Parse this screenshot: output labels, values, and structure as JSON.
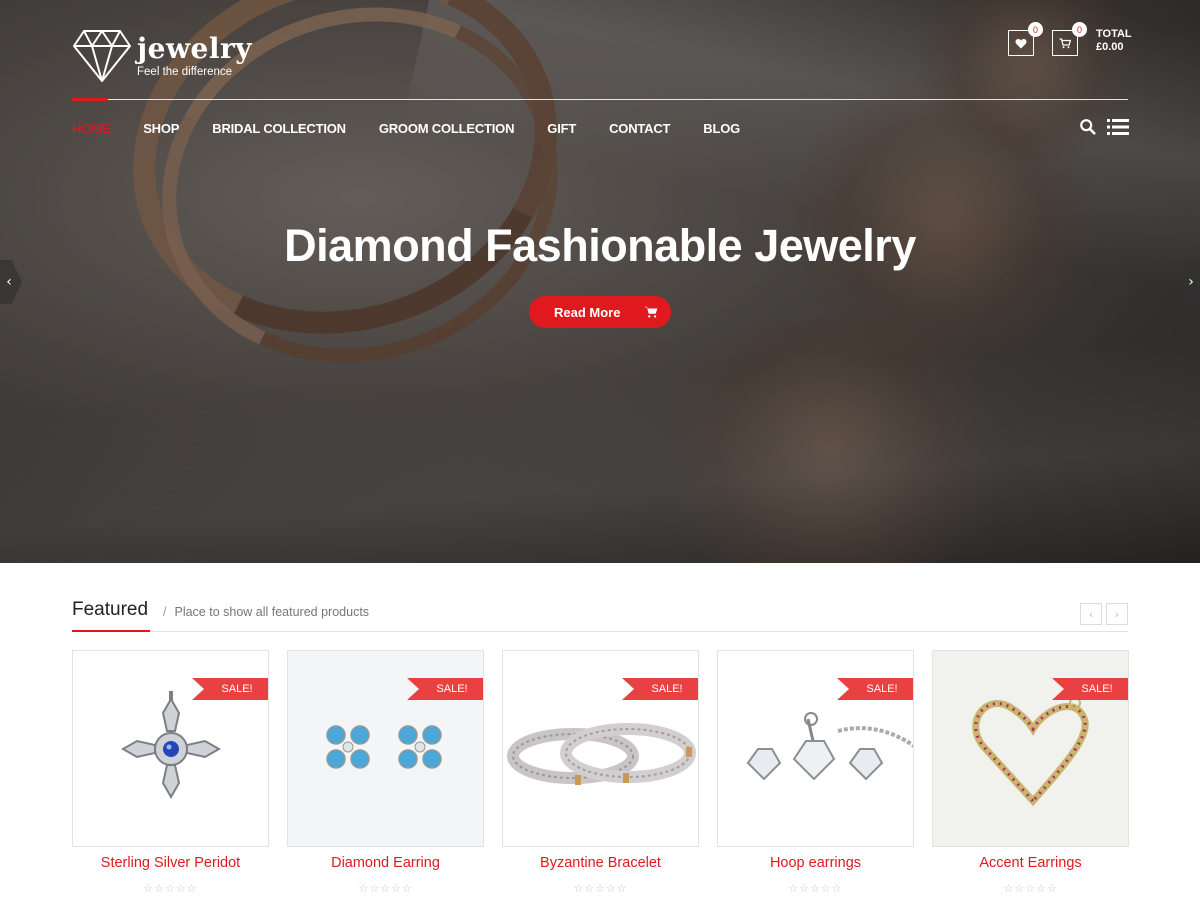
{
  "brand": {
    "name": "jewelry",
    "tagline": "Feel the difference"
  },
  "header": {
    "wishlist_count": "0",
    "cart_count": "0",
    "total_label": "TOTAL",
    "total_value": "£0.00"
  },
  "nav": {
    "items": [
      "HOME",
      "SHOP",
      "BRIDAL COLLECTION",
      "GROOM COLLECTION",
      "GIFT",
      "CONTACT",
      "BLOG"
    ],
    "active_index": 0
  },
  "hero": {
    "title": "Diamond Fashionable Jewelry",
    "button_label": "Read More",
    "prev_arrow": "‹",
    "next_arrow": "›"
  },
  "featured": {
    "title": "Featured",
    "separator": "/",
    "subtitle": "Place to show all featured products",
    "prev": "‹",
    "next": "›",
    "products": [
      {
        "name": "Sterling Silver Peridot",
        "badge": "SALE!",
        "rating": "☆☆☆☆☆"
      },
      {
        "name": "Diamond Earring",
        "badge": "SALE!",
        "rating": "☆☆☆☆☆"
      },
      {
        "name": "Byzantine Bracelet",
        "badge": "SALE!",
        "rating": "☆☆☆☆☆"
      },
      {
        "name": "Hoop earrings",
        "badge": "SALE!",
        "rating": "☆☆☆☆☆"
      },
      {
        "name": "Accent Earrings",
        "badge": "SALE!",
        "rating": "☆☆☆☆☆"
      }
    ]
  },
  "colors": {
    "accent": "#e0191f",
    "sale_badge": "#e94141"
  },
  "icons": [
    "diamond-logo-icon",
    "heart-icon",
    "cart-icon",
    "search-icon",
    "list-icon"
  ]
}
